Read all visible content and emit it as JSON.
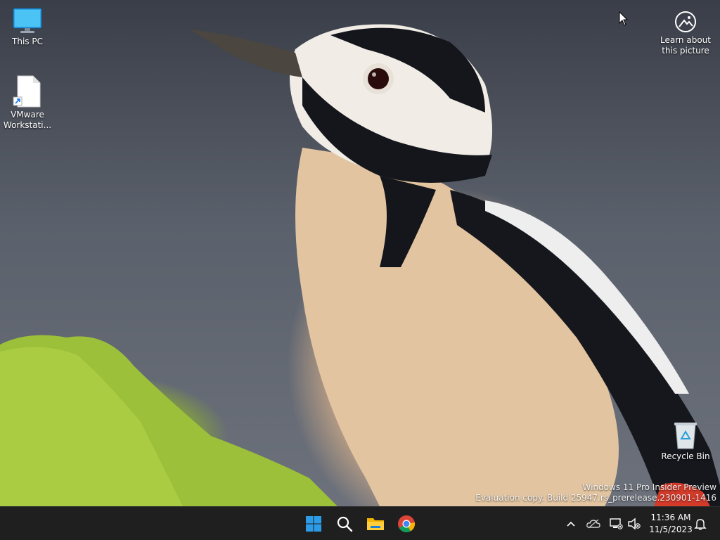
{
  "desktop": {
    "icons": [
      {
        "label": "This PC",
        "icon": "monitor-icon"
      },
      {
        "label": "VMware Workstati...",
        "icon": "file-shortcut-icon"
      },
      {
        "label": "Learn about this picture",
        "icon": "learn-picture-icon"
      },
      {
        "label": "Recycle Bin",
        "icon": "recycle-bin-icon"
      }
    ],
    "watermark": {
      "line1": "Windows 11 Pro Insider Preview",
      "line2": "Evaluation copy. Build 25947.rs_prerelease.230901-1416"
    }
  },
  "taskbar": {
    "apps": [
      {
        "name": "Start",
        "icon": "windows-logo-icon"
      },
      {
        "name": "Search",
        "icon": "search-icon"
      },
      {
        "name": "File Explorer",
        "icon": "folder-icon"
      },
      {
        "name": "Google Chrome",
        "icon": "chrome-icon"
      }
    ],
    "tray": {
      "icons": [
        "chevron-up-icon",
        "onedrive-icon",
        "network-icon",
        "volume-muted-icon",
        "bell-icon"
      ],
      "time": "11:36 AM",
      "date": "11/5/2023"
    }
  },
  "colors": {
    "taskbar_bg": "#1f1f1f",
    "accent_blue": "#0078d4",
    "background_gray": "#5b616c",
    "moss_green": "#9cc03a"
  }
}
